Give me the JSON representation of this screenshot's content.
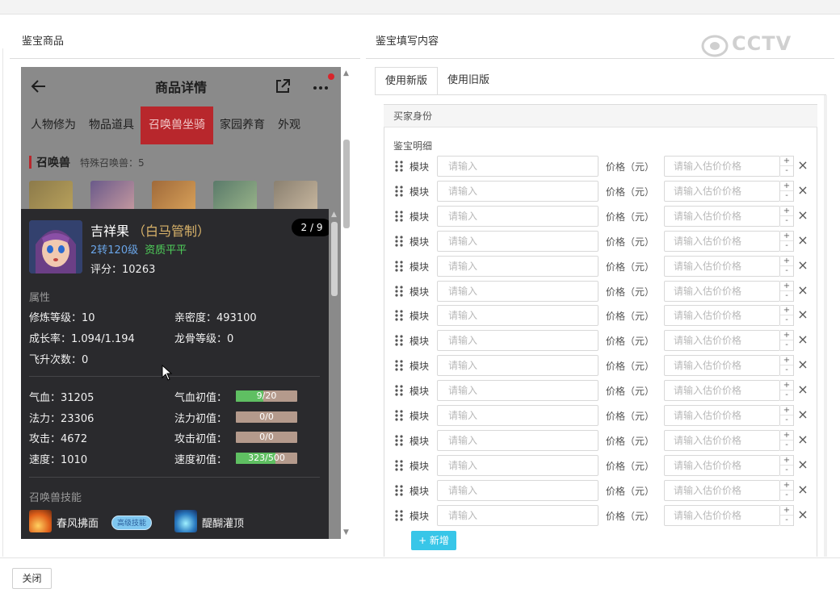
{
  "left_title": "鉴宝商品",
  "right_title": "鉴宝填写内容",
  "watermark": "CCTV",
  "phone": {
    "header_title": "商品详情",
    "categories": [
      "人物修为",
      "物品道具",
      "召唤兽坐骑",
      "家园养育",
      "外观"
    ],
    "section_title": "召唤兽",
    "section_sub": "特殊召唤兽：5"
  },
  "pet": {
    "name": "吉祥果",
    "sub_name": "（白马管制）",
    "level": "2转120级",
    "quality": "资质平平",
    "score": "评分：10263",
    "pager": "2 / 9",
    "attr_header": "属性",
    "attrs": [
      "修炼等级：10",
      "亲密度：493100",
      "成长率：1.094/1.194",
      "龙骨等级：0",
      "飞升次数：0"
    ],
    "stats": [
      {
        "label": "气血：31205",
        "init_label": "气血初值：",
        "bar_text": "9/20",
        "fill": 0.45
      },
      {
        "label": "法力：23306",
        "init_label": "法力初值：",
        "bar_text": "0/0",
        "fill": 0
      },
      {
        "label": "攻击：4672",
        "init_label": "攻击初值：",
        "bar_text": "0/0",
        "fill": 0
      },
      {
        "label": "速度：1010",
        "init_label": "速度初值：",
        "bar_text": "323/500",
        "fill": 0.646
      }
    ],
    "skill_header": "召唤兽技能",
    "skills": [
      "春风拂面",
      "醍醐灌顶"
    ],
    "skill_badge": "高级技能"
  },
  "tabs": [
    "使用新版",
    "使用旧版"
  ],
  "form": {
    "head": "买家身份",
    "detail_label": "鉴宝明细",
    "module_label": "模块",
    "input_placeholder": "请输入",
    "price_label": "价格（元）",
    "price_placeholder": "请输入估价价格",
    "plus": "+",
    "minus": "-",
    "remove": "×",
    "row_count": 15,
    "add_label": "+ 新增"
  },
  "close_label": "关闭"
}
